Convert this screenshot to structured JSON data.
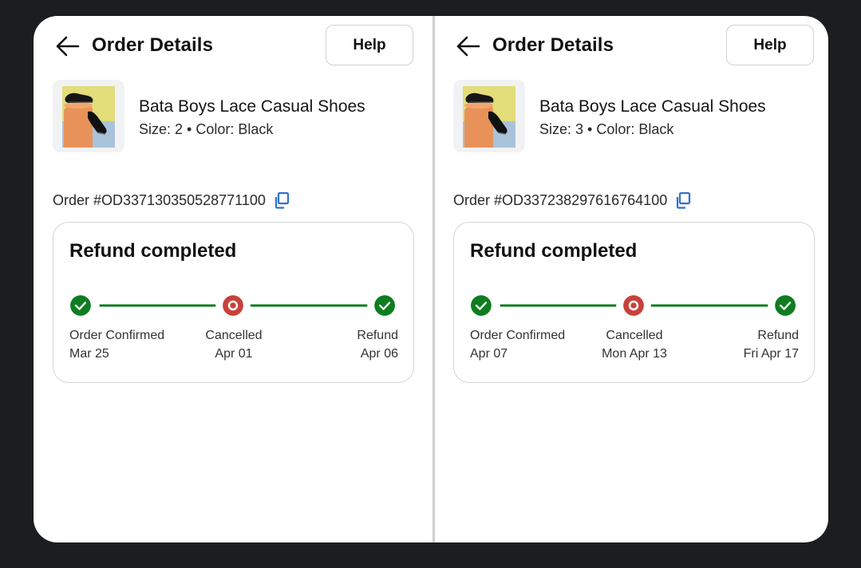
{
  "colors": {
    "success": "#0e7d1f",
    "cancel": "#c8413b",
    "copy_icon": "#2f6fd1",
    "line": "#0e7d1f"
  },
  "panels": [
    {
      "header": {
        "title": "Order Details",
        "help_label": "Help",
        "back_icon": "arrow-left-icon"
      },
      "product": {
        "name": "Bata Boys Lace Casual Shoes",
        "meta": "Size: 2 • Color: Black"
      },
      "order": {
        "id": "Order #OD337130350528771100",
        "copy_icon": "copy-icon"
      },
      "status": {
        "title": "Refund completed",
        "steps": [
          {
            "label": "Order Confirmed",
            "date": "Mar 25",
            "state": "done",
            "icon": "check-circle-icon"
          },
          {
            "label": "Cancelled",
            "date": "Apr 01",
            "state": "cancelled",
            "icon": "cancel-circle-icon"
          },
          {
            "label": "Refund",
            "date": "Apr 06",
            "state": "done",
            "icon": "check-circle-icon"
          }
        ]
      }
    },
    {
      "header": {
        "title": "Order Details",
        "help_label": "Help",
        "back_icon": "arrow-left-icon"
      },
      "product": {
        "name": "Bata Boys Lace Casual Shoes",
        "meta": "Size: 3 • Color: Black"
      },
      "order": {
        "id": "Order #OD337238297616764100",
        "copy_icon": "copy-icon"
      },
      "status": {
        "title": "Refund completed",
        "steps": [
          {
            "label": "Order Confirmed",
            "date": "Apr 07",
            "state": "done",
            "icon": "check-circle-icon"
          },
          {
            "label": "Cancelled",
            "date": "Mon Apr 13",
            "state": "cancelled",
            "icon": "cancel-circle-icon"
          },
          {
            "label": "Refund",
            "date": "Fri Apr 17",
            "state": "done",
            "icon": "check-circle-icon"
          }
        ]
      }
    }
  ]
}
